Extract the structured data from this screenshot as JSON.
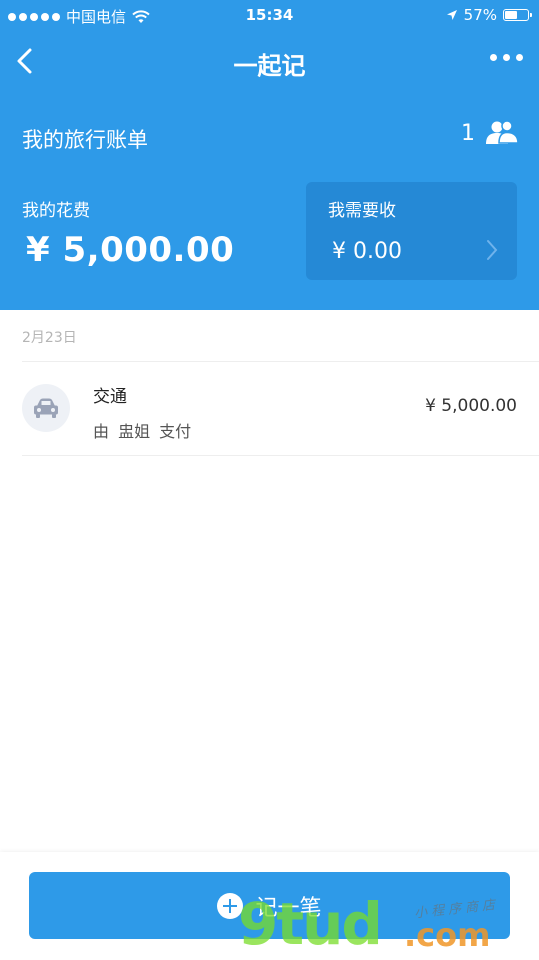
{
  "status_bar": {
    "carrier": "中国电信",
    "time": "15:34",
    "battery": "57%",
    "battery_level": 0.57
  },
  "nav": {
    "title": "一起记"
  },
  "summary": {
    "bill_name": "我的旅行账单",
    "member_count": "1",
    "my_spend_label": "我的花费",
    "my_spend_amount": "¥ 5,000.00",
    "receive_label": "我需要收",
    "receive_amount": "¥ 0.00"
  },
  "records": {
    "date": "2月23日",
    "items": [
      {
        "category": "交通",
        "payer_text": "由 盅姐 支付",
        "amount": "¥ 5,000.00",
        "icon": "car-icon"
      }
    ]
  },
  "bottom": {
    "add_label": "记一笔"
  },
  "watermark": {
    "big": "9tud",
    "dotcom": ".com",
    "small": "小程序商店"
  },
  "colors": {
    "primary": "#2e9ae8",
    "card": "#2589d6",
    "icon_gray": "#9aa3b7"
  }
}
